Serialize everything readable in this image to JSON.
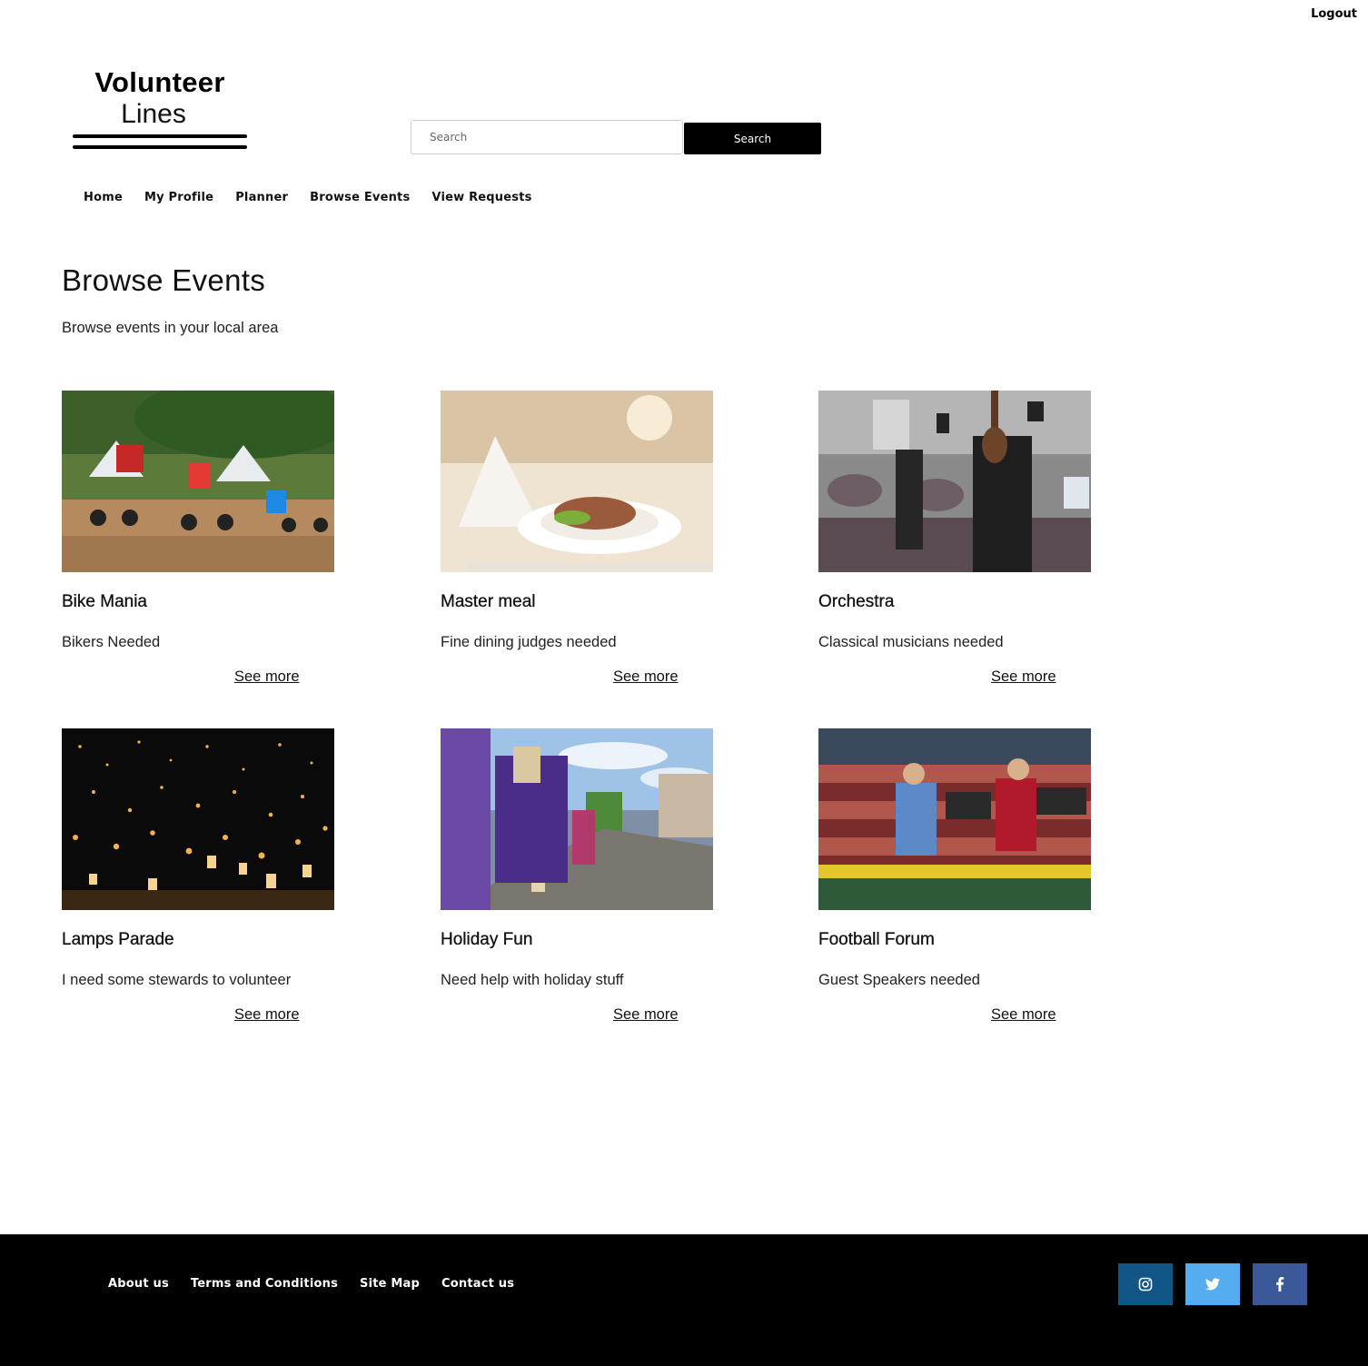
{
  "header": {
    "logout_label": "Logout",
    "logo": {
      "line1": "Volunteer",
      "line2": "Lines"
    },
    "search": {
      "placeholder": "Search",
      "value": "",
      "button_label": "Search"
    }
  },
  "nav": {
    "items": [
      {
        "label": "Home"
      },
      {
        "label": "My Profile"
      },
      {
        "label": "Planner"
      },
      {
        "label": "Browse Events"
      },
      {
        "label": "View Requests"
      }
    ]
  },
  "main": {
    "title": "Browse Events",
    "subtitle": "Browse events in your local area",
    "events": [
      {
        "title": "Bike Mania",
        "description": "Bikers Needed",
        "link_label": "See more",
        "image": "motocross-photo"
      },
      {
        "title": "Master meal",
        "description": "Fine dining judges needed",
        "link_label": "See more",
        "image": "dinner-plate-photo"
      },
      {
        "title": "Orchestra",
        "description": "Classical musicians needed",
        "link_label": "See more",
        "image": "orchestra-photo"
      },
      {
        "title": "Lamps Parade",
        "description": "I need some stewards to volunteer",
        "link_label": "See more",
        "image": "lanterns-photo"
      },
      {
        "title": "Holiday Fun",
        "description": "Need help with holiday stuff",
        "link_label": "See more",
        "image": "parade-photo"
      },
      {
        "title": "Football Forum",
        "description": "Guest Speakers needed",
        "link_label": "See more",
        "image": "stadium-cameras-photo"
      }
    ]
  },
  "footer": {
    "links": [
      {
        "label": "About us"
      },
      {
        "label": "Terms and Conditions"
      },
      {
        "label": "Site Map"
      },
      {
        "label": "Contact us"
      }
    ],
    "social": [
      {
        "icon": "instagram-icon",
        "color": "#125688"
      },
      {
        "icon": "twitter-icon",
        "color": "#55acee"
      },
      {
        "icon": "facebook-icon",
        "color": "#3b5998"
      }
    ]
  }
}
